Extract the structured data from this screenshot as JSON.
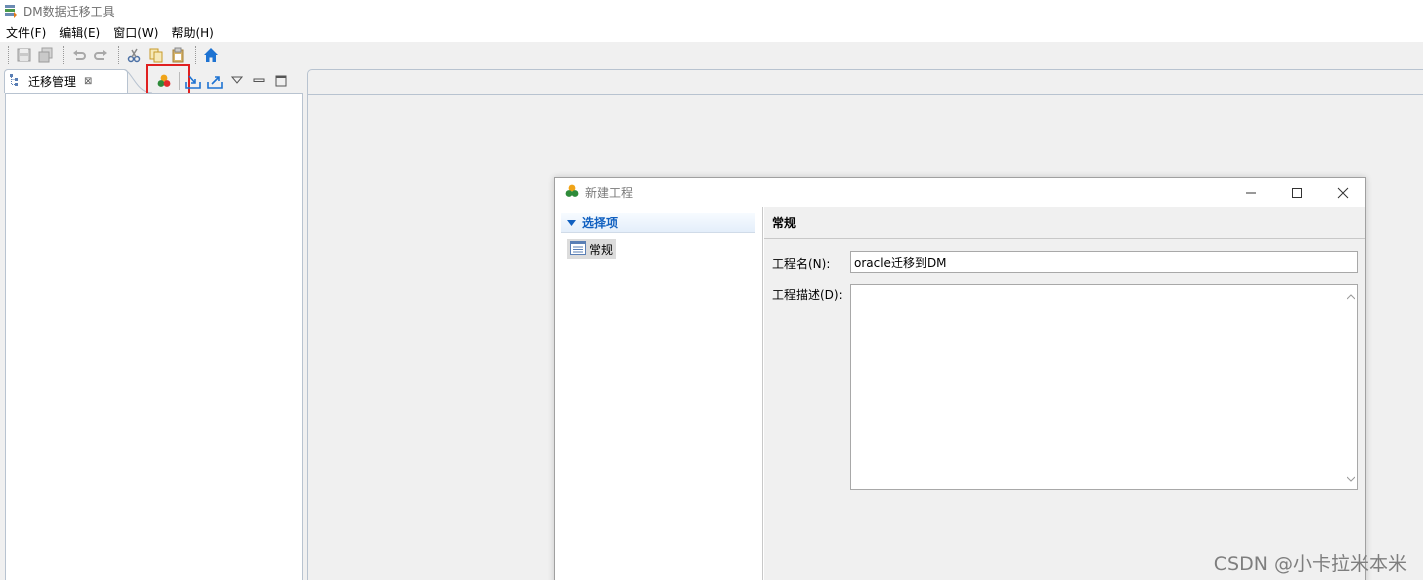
{
  "window": {
    "title": "DM数据迁移工具"
  },
  "menu": [
    "文件(F)",
    "编辑(E)",
    "窗口(W)",
    "帮助(H)"
  ],
  "toolbar": {
    "icons": [
      "save-icon",
      "save-all-icon",
      "undo-icon",
      "redo-icon",
      "cut-icon",
      "copy-icon",
      "paste-icon",
      "home-icon"
    ]
  },
  "left_view": {
    "tab_label": "迁移管理",
    "tab_close": "⊠",
    "actions": [
      "new-project-icon",
      "import-icon",
      "export-icon",
      "view-menu-icon",
      "minimize-icon",
      "maximize-icon"
    ]
  },
  "dialog": {
    "title": "新建工程",
    "tree": {
      "header": "选择项",
      "items": [
        "常规"
      ]
    },
    "section_title": "常规",
    "fields": {
      "name_label": "工程名(N):",
      "name_value": "oracle迁移到DM",
      "desc_label": "工程描述(D):",
      "desc_value": ""
    },
    "window_buttons": [
      "minimize",
      "maximize",
      "close"
    ]
  },
  "watermark": "CSDN @小卡拉米本米",
  "colors": {
    "accent": "#1060c0",
    "highlight_box": "#e02020",
    "home_icon": "#1e73d2"
  }
}
